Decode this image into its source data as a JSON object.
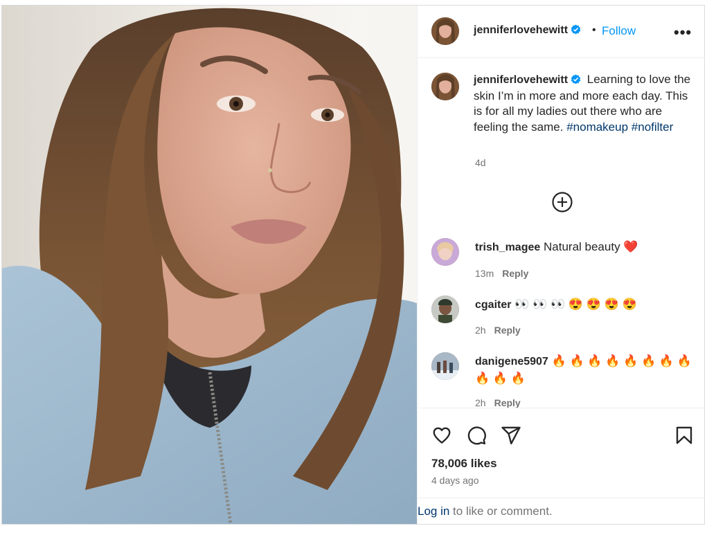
{
  "post": {
    "username": "jenniferlovehewitt",
    "follow_label": "Follow",
    "separator": "•",
    "more_label": "•••",
    "caption_text": "Learning to love the skin I’m in more and more each day. This is for all my ladies out there who are feeling the same.",
    "hashtags": [
      "#nomakeup",
      "#nofilter"
    ],
    "caption_age": "4d",
    "likes": "78,006 likes",
    "posted": "4 days ago"
  },
  "comments": [
    {
      "username": "trish_magee",
      "text": "Natural beauty",
      "emoji": "❤️",
      "age": "13m",
      "reply": "Reply"
    },
    {
      "username": "cgaiter",
      "text": "",
      "emoji": "👀 👀 👀 😍 😍 😍 😍",
      "age": "2h",
      "reply": "Reply"
    },
    {
      "username": "danigene5907",
      "text": "",
      "emoji": "🔥 🔥 🔥 🔥 🔥 🔥 🔥 🔥 🔥 🔥 🔥",
      "age": "2h",
      "reply": "Reply"
    }
  ],
  "footer": {
    "login_link": "Log in",
    "login_rest": " to like or comment."
  },
  "colors": {
    "link_blue": "#0095f6",
    "hashtag": "#00376b",
    "secondary_text": "#737373",
    "verified_badge": "#0095f6"
  },
  "icons": [
    "verified-icon",
    "more-icon",
    "add-circle-icon",
    "heart-icon",
    "comment-icon",
    "share-icon",
    "bookmark-icon"
  ]
}
